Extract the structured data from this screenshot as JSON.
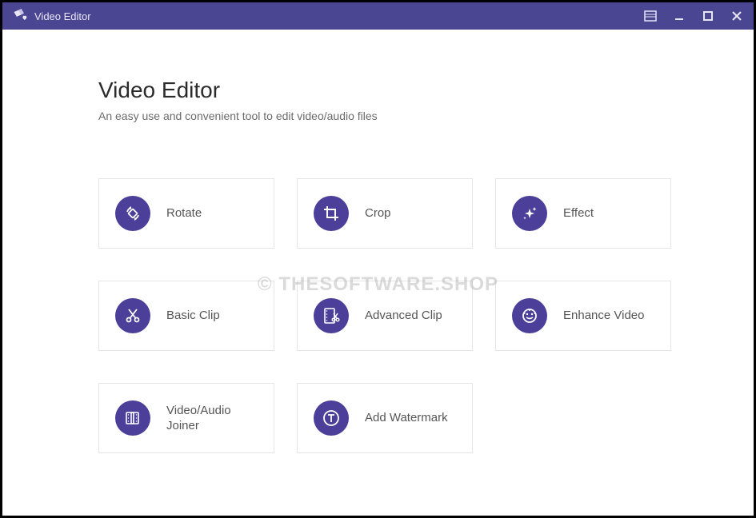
{
  "titlebar": {
    "app_name": "Video Editor"
  },
  "header": {
    "title": "Video Editor",
    "subtitle": "An easy use and convenient tool to edit video/audio files"
  },
  "tools": [
    {
      "id": "rotate",
      "label": "Rotate"
    },
    {
      "id": "crop",
      "label": "Crop"
    },
    {
      "id": "effect",
      "label": "Effect"
    },
    {
      "id": "basic-clip",
      "label": "Basic Clip"
    },
    {
      "id": "advanced-clip",
      "label": "Advanced Clip"
    },
    {
      "id": "enhance-video",
      "label": "Enhance Video"
    },
    {
      "id": "video-audio-joiner",
      "label": "Video/Audio Joiner"
    },
    {
      "id": "add-watermark",
      "label": "Add Watermark"
    }
  ],
  "watermark_text": "© THESOFTWARE.SHOP",
  "colors": {
    "titlebar_bg": "#4b4692",
    "icon_bg": "#4b3f9a",
    "border": "#e5e5e5"
  }
}
